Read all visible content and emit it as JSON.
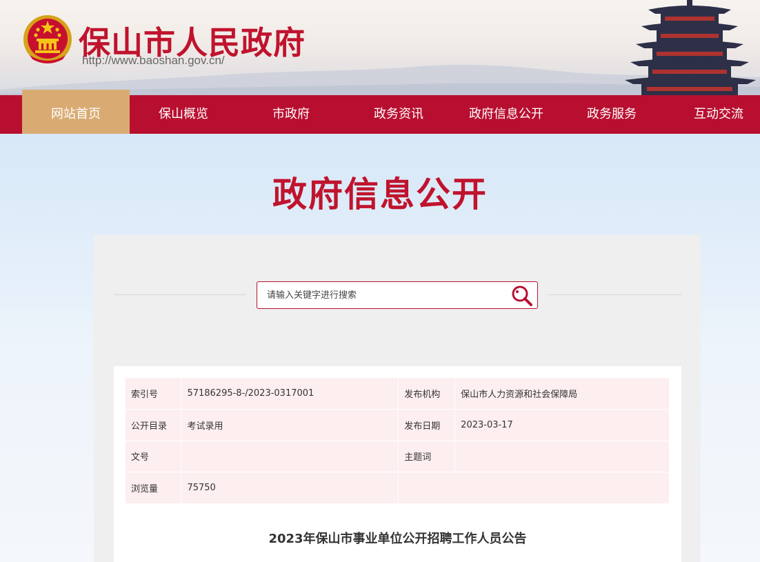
{
  "header": {
    "site_name": "保山市人民政府",
    "site_url": "http://www.baoshan.gov.cn/"
  },
  "nav": {
    "items": [
      {
        "label": "网站首页",
        "active": true
      },
      {
        "label": "保山概览",
        "active": false
      },
      {
        "label": "市政府",
        "active": false
      },
      {
        "label": "政务资讯",
        "active": false
      },
      {
        "label": "政府信息公开",
        "active": false
      },
      {
        "label": "政务服务",
        "active": false
      },
      {
        "label": "互动交流",
        "active": false
      }
    ]
  },
  "section_title": "政府信息公开",
  "search": {
    "placeholder": "请输入关键字进行搜索",
    "icon": "magnifier-icon"
  },
  "meta": {
    "index_label": "索引号",
    "index_value": "57186295-8-/2023-0317001",
    "publisher_label": "发布机构",
    "publisher_value": "保山市人力资源和社会保障局",
    "catalog_label": "公开目录",
    "catalog_value": "考试录用",
    "date_label": "发布日期",
    "date_value": "2023-03-17",
    "docno_label": "文号",
    "docno_value": "",
    "subject_label": "主题词",
    "subject_value": "",
    "views_label": "浏览量",
    "views_value": "75750"
  },
  "document_title": "2023年保山市事业单位公开招聘工作人员公告",
  "colors": {
    "brand_red": "#b80f30",
    "active_tab": "#d9ab72",
    "title_red": "#c0132d",
    "table_bg": "#fdeef0"
  }
}
